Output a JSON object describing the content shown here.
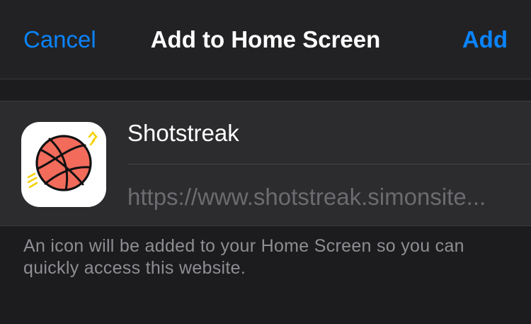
{
  "navbar": {
    "cancel_label": "Cancel",
    "title": "Add to Home Screen",
    "add_label": "Add"
  },
  "app": {
    "icon": "basketball-icon",
    "name": "Shotstreak",
    "url": "https://www.shotstreak.simonsite..."
  },
  "footer": {
    "note": "An icon will be added to your Home Screen so you can quickly access this website."
  },
  "colors": {
    "background": "#1c1c1e",
    "card": "#2c2c2e",
    "accent": "#0a84ff",
    "ball": "#f26b5b",
    "motion_lines": "#f5d10a"
  }
}
